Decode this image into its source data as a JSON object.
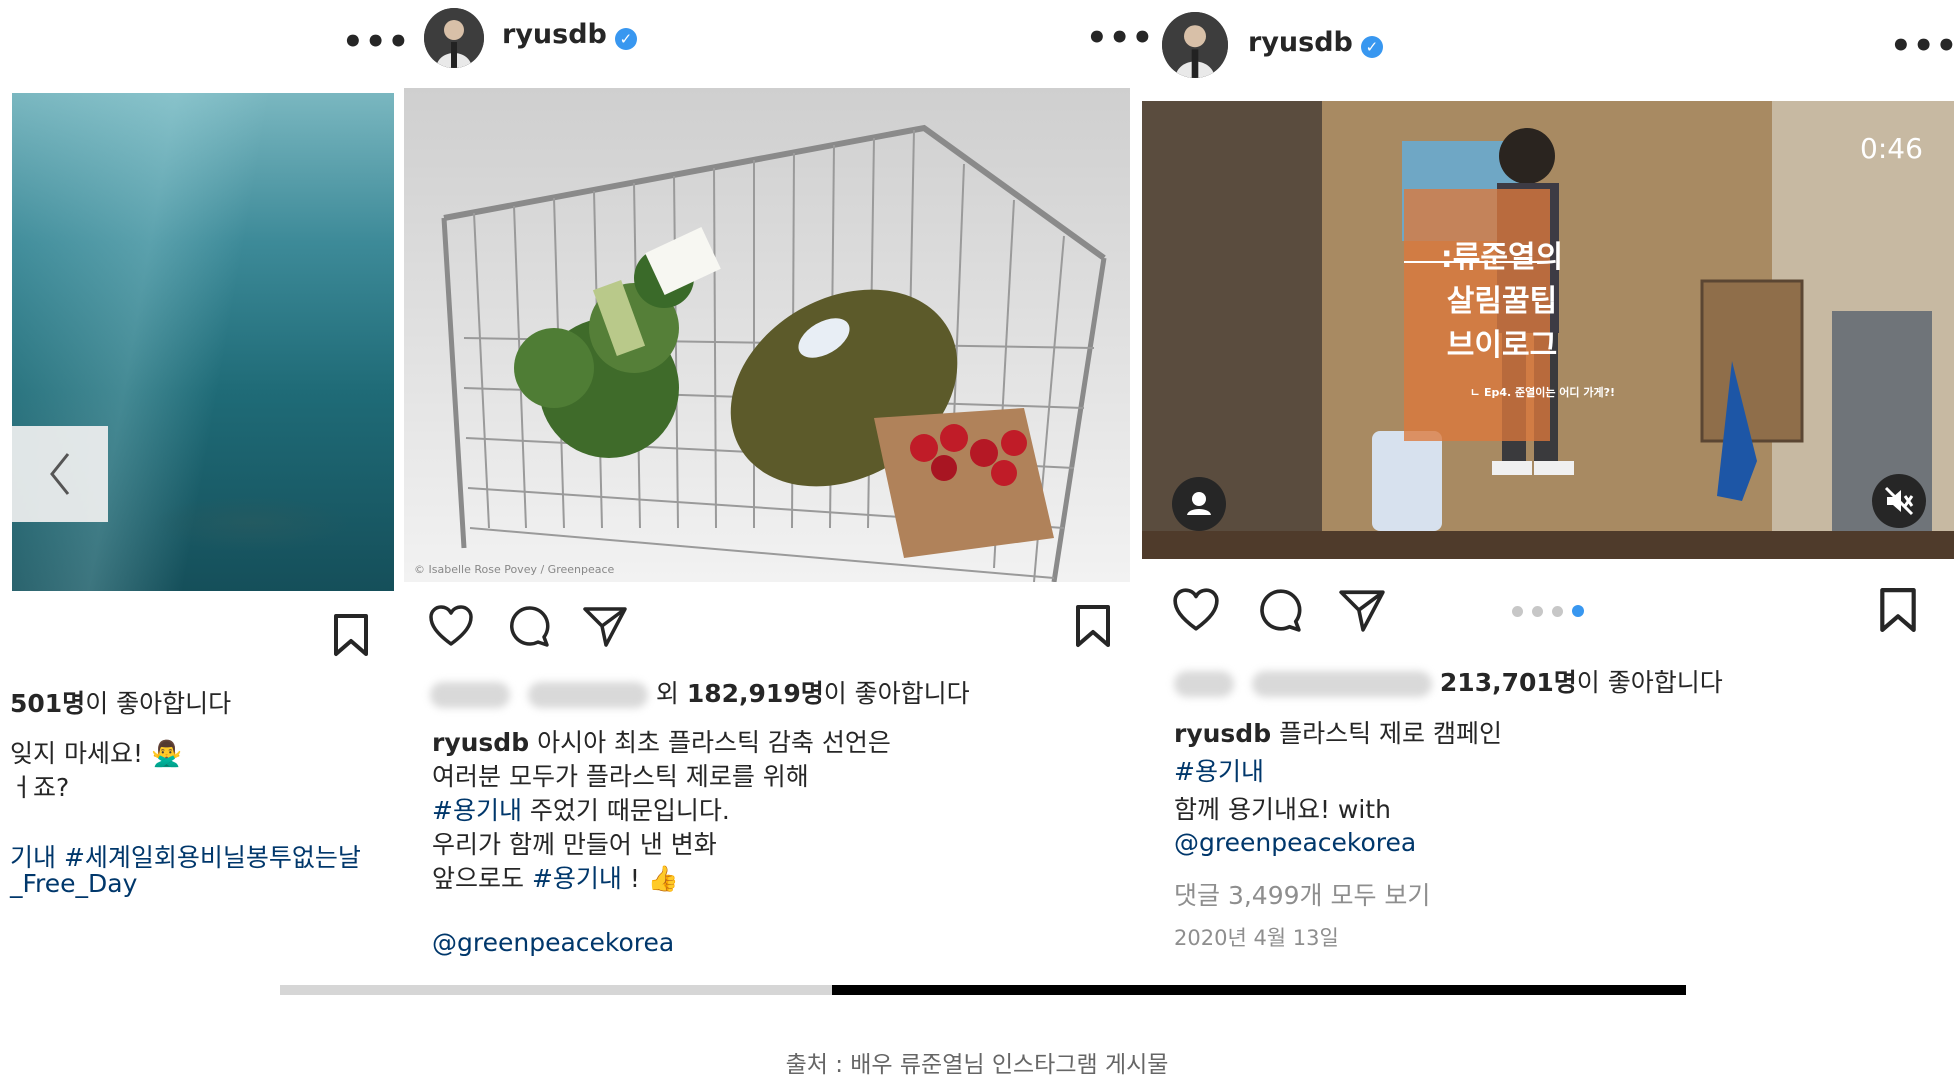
{
  "post1": {
    "likes_count": "501명",
    "likes_suffix": "이 좋아합니다",
    "caption_line1": "잊지 마세요!",
    "caption_line2": "ㅓ죠?",
    "hashtags_line1": "기내 #세계일회용비닐봉투없는날",
    "hashtags_line2": "_Free_Day",
    "emoji": "🙅‍♂️"
  },
  "post2": {
    "username": "ryusdb",
    "likes_prefix": "외 ",
    "likes_count": "182,919명",
    "likes_suffix": "이 좋아합니다",
    "caption_lines": [
      "아시아 최초 플라스틱 감축 선언은",
      "여러분 모두가 플라스틱 제로를 위해"
    ],
    "hashtag_line_tag": "#용기내",
    "hashtag_line_rest": " 주었기 때문입니다.",
    "line4": "우리가 함께 만들어 낸 변화",
    "line5_prefix": "앞으로도 ",
    "line5_tag": "#용기내",
    "line5_suffix": " ! 👍",
    "mention": "@greenpeacekorea",
    "image_credit": "© Isabelle Rose Povey / Greenpeace"
  },
  "post3": {
    "username": "ryusdb",
    "video_time": "0:46",
    "overlay_title_line1": ":류준열의",
    "overlay_title_line2": "살림꿀팁",
    "overlay_title_line3": "브이로그",
    "overlay_subtitle": "ㄴ Ep4. 준열이는 어디 가게?!",
    "likes_count": "213,701명",
    "likes_suffix": "이 좋아합니다",
    "caption_first": "플라스틱 제로 캠페인",
    "hashtag": "#용기내",
    "caption_line3": "함께 용기내요! with",
    "mention": "@greenpeacekorea",
    "comments_link": "댓글 3,499개 모두 보기",
    "date": "2020년 4월 13일",
    "carousel_dots": 4,
    "carousel_active": 4
  },
  "source_caption": "출처 : 배우 류준열님 인스타그램 게시물",
  "colors": {
    "link": "#00376b",
    "verified": "#3897f0",
    "dot_active": "#3897f0",
    "dot_inactive": "#c7c7c7"
  }
}
